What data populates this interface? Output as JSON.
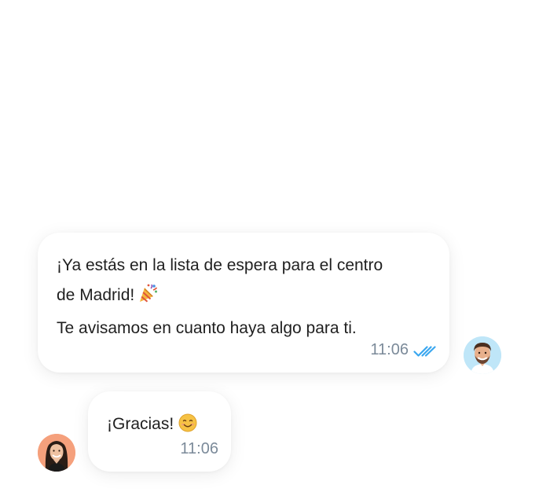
{
  "messages": {
    "outgoing": {
      "line1": "¡Ya estás en la lista de espera para el centro",
      "line2": "de Madrid!",
      "line2_emoji": "party-popper-emoji",
      "line3": "Te avisamos en cuanto haya algo para ti.",
      "time": "11:06",
      "status": "read",
      "status_icon": "double-check-icon",
      "status_color": "#3aa7ef",
      "avatar": "man-avatar"
    },
    "incoming": {
      "text": "¡Gracias!",
      "emoji": "smiling-face-emoji",
      "time": "11:06",
      "avatar": "woman-avatar"
    }
  },
  "colors": {
    "background": "#ffffff",
    "bubble": "#ffffff",
    "text": "#1f1f1f",
    "timestamp": "#7b8a99"
  }
}
